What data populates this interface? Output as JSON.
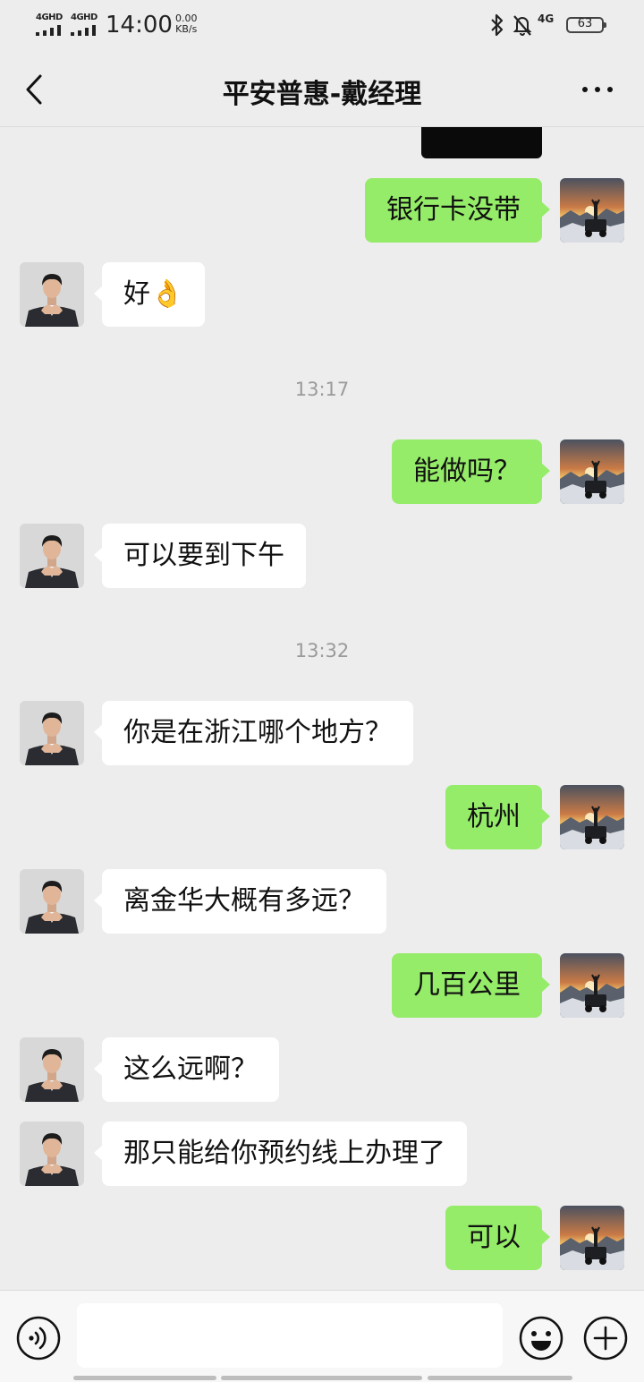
{
  "status_bar": {
    "sim1_label": "4GHD",
    "sim2_label": "4GHD",
    "time": "14:00",
    "net_speed_value": "0.00",
    "net_speed_unit": "KB/s",
    "network_label": "4G",
    "battery_level": "63",
    "icons": [
      "bluetooth-icon",
      "bell-off-icon"
    ]
  },
  "header": {
    "title": "平安普惠-戴经理",
    "back_icon": "chevron-left-icon",
    "more_icon": "more-dots-icon"
  },
  "messages": [
    {
      "from": "me",
      "text": "银行卡没带"
    },
    {
      "from": "contact",
      "text": "好👌"
    },
    {
      "timestamp": "13:17"
    },
    {
      "from": "me",
      "text": "能做吗？"
    },
    {
      "from": "contact",
      "text": "可以要到下午"
    },
    {
      "timestamp": "13:32"
    },
    {
      "from": "contact",
      "text": "你是在浙江哪个地方？"
    },
    {
      "from": "me",
      "text": "杭州"
    },
    {
      "from": "contact",
      "text": "离金华大概有多远？"
    },
    {
      "from": "me",
      "text": "几百公里"
    },
    {
      "from": "contact",
      "text": "这么远啊？"
    },
    {
      "from": "contact",
      "text": "那只能给你预约线上办理了"
    },
    {
      "from": "me",
      "text": "可以"
    }
  ],
  "input_bar": {
    "voice_icon": "voice-icon",
    "message_value": "",
    "emoji_icon": "emoji-icon",
    "plus_icon": "plus-circle-icon"
  },
  "colors": {
    "background": "#ededed",
    "outgoing_bubble": "#95ec69",
    "incoming_bubble": "#ffffff",
    "timestamp_text": "#9a9a9a"
  }
}
